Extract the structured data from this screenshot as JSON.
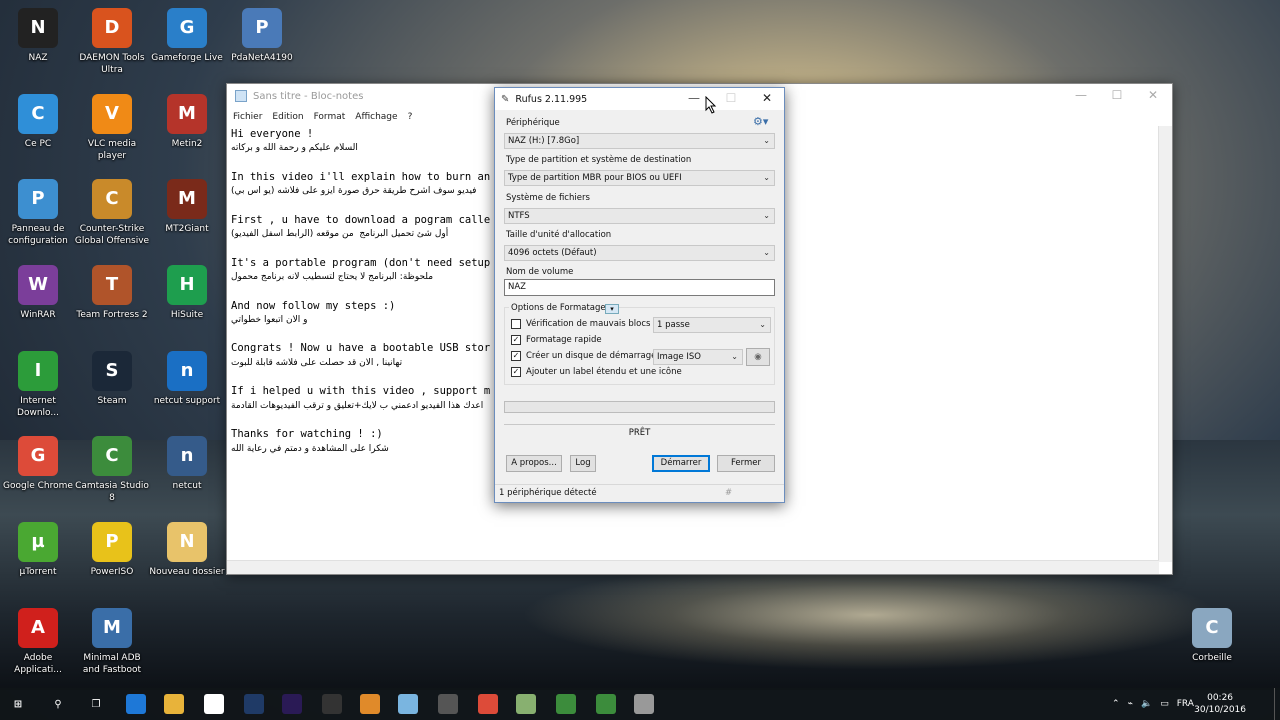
{
  "desktop": {
    "icons": [
      {
        "label": "NAZ",
        "icon": "ghost-icon",
        "color": "#222222"
      },
      {
        "label": "DAEMON Tools Ultra",
        "icon": "daemon-tools-icon",
        "color": "#d9531e"
      },
      {
        "label": "Gameforge Live",
        "icon": "gameforge-icon",
        "color": "#2a7fc9"
      },
      {
        "label": "PdaNetA4190",
        "icon": "pdanet-icon",
        "color": "#4a7ab8"
      },
      {
        "label": "Ce PC",
        "icon": "computer-icon",
        "color": "#2f8fd8"
      },
      {
        "label": "VLC media player",
        "icon": "vlc-icon",
        "color": "#f08a16"
      },
      {
        "label": "Metin2",
        "icon": "metin2-icon",
        "color": "#b5342a"
      },
      {
        "label": "Panneau de configuration",
        "icon": "control-panel-icon",
        "color": "#3d8fd0"
      },
      {
        "label": "Counter-Strike Global Offensive",
        "icon": "csgo-icon",
        "color": "#c98a2a"
      },
      {
        "label": "MT2Giant",
        "icon": "mt2giant-icon",
        "color": "#7a2a1a"
      },
      {
        "label": "WinRAR",
        "icon": "winrar-icon",
        "color": "#7b3e9a"
      },
      {
        "label": "Team Fortress 2",
        "icon": "tf2-icon",
        "color": "#b0542a"
      },
      {
        "label": "HiSuite",
        "icon": "hisuite-icon",
        "color": "#1e9e4e"
      },
      {
        "label": "Internet Downlo...",
        "icon": "idm-icon",
        "color": "#2c9c3a"
      },
      {
        "label": "Steam",
        "icon": "steam-icon",
        "color": "#1b2838"
      },
      {
        "label": "netcut support",
        "icon": "ie-icon",
        "color": "#1a6fc4"
      },
      {
        "label": "Google Chrome",
        "icon": "chrome-icon",
        "color": "#dd4b39"
      },
      {
        "label": "Camtasia Studio 8",
        "icon": "camtasia-icon",
        "color": "#3c8c3c"
      },
      {
        "label": "netcut",
        "icon": "netcut-icon",
        "color": "#355b8a"
      },
      {
        "label": "µTorrent",
        "icon": "utorrent-icon",
        "color": "#4aa832"
      },
      {
        "label": "PowerISO",
        "icon": "poweriso-icon",
        "color": "#e8c21a"
      },
      {
        "label": "Nouveau dossier",
        "icon": "folder-icon",
        "color": "#e8c36a"
      },
      {
        "label": "Adobe Applicati...",
        "icon": "adobe-icon",
        "color": "#d0201c"
      },
      {
        "label": "Minimal ADB and Fastboot",
        "icon": "adb-icon",
        "color": "#3a6ea8"
      },
      {
        "label": "Corbeille",
        "icon": "recycle-bin-icon",
        "color": "#8aa7c0"
      }
    ]
  },
  "notepad": {
    "title": "Sans titre - Bloc-notes",
    "menu": [
      "Fichier",
      "Edition",
      "Format",
      "Affichage",
      "?"
    ],
    "lines": [
      {
        "t": "Hi everyone !",
        "ar": false
      },
      {
        "t": "السلام عليكم و رحمة الله و بركاته",
        "ar": true
      },
      {
        "t": "",
        "ar": false
      },
      {
        "t": "In this video i'll explain how to burn an",
        "ar": false
      },
      {
        "t": "فيديو سوف اشرح طريقة حرق صورة ايزو على فلاشه (يو اس بي)",
        "ar": true
      },
      {
        "t": "",
        "ar": false
      },
      {
        "t": "First , u have to download a pogram calle",
        "ar": false
      },
      {
        "t": "أول شئ تحميل البرنامج  من موقعه (الرابط اسفل الفيديو)",
        "ar": true
      },
      {
        "t": "",
        "ar": false
      },
      {
        "t": "It's a portable program (don't need setup",
        "ar": false
      },
      {
        "t": "ملحوظة: البرنامج لا يحتاج لتسطيب لانه برنامج محمول",
        "ar": true
      },
      {
        "t": "",
        "ar": false
      },
      {
        "t": "And now follow my steps :)",
        "ar": false
      },
      {
        "t": "و الان اتبعوا خطواتي",
        "ar": true
      },
      {
        "t": "",
        "ar": false
      },
      {
        "t": "Congrats ! Now u have a bootable USB stor",
        "ar": false
      },
      {
        "t": "تهانينا , الان قد حصلت على فلاشه قابلة للبوت",
        "ar": true
      },
      {
        "t": "",
        "ar": false
      },
      {
        "t": "If i helped u with this video , support m",
        "ar": false
      },
      {
        "t": "اعدك هذا الفيديو ادعمني ب لايك+تعليق و ترقب الفيديوهات القادمة",
        "ar": true
      },
      {
        "t": "",
        "ar": false
      },
      {
        "t": "Thanks for watching ! :)",
        "ar": false
      },
      {
        "t": "شكرا على المشاهدة و دمتم في رعاية الله",
        "ar": true
      }
    ]
  },
  "rufus": {
    "title": "Rufus 2.11.995",
    "device_label": "Périphérique",
    "device_value": "NAZ (H:) [7.8Go]",
    "partition_label": "Type de partition et système de destination",
    "partition_value": "Type de partition MBR pour BIOS ou UEFI",
    "fs_label": "Système de fichiers",
    "fs_value": "NTFS",
    "cluster_label": "Taille d'unité d'allocation",
    "cluster_value": "4096 octets (Défaut)",
    "volume_label": "Nom de volume",
    "volume_value": "NAZ",
    "format_options_label": "Options de Formatage",
    "badblocks_label": "Vérification de mauvais blocs",
    "badblocks_checked": false,
    "passes_value": "1 passe",
    "quick_format_label": "Formatage rapide",
    "quick_format_checked": true,
    "bootable_label": "Créer un disque de démarrage",
    "bootable_checked": true,
    "boot_type_value": "Image ISO",
    "extended_label": "Ajouter un label étendu et une icône",
    "extended_checked": true,
    "status": "PRÊT",
    "about_button": "A propos...",
    "log_button": "Log",
    "start_button": "Démarrer",
    "close_button": "Fermer",
    "footer_text": "1 périphérique détecté",
    "footer_hash": "#"
  },
  "taskbar": {
    "apps": [
      {
        "name": "start-icon",
        "color": "#ffffff"
      },
      {
        "name": "search-icon",
        "color": "#ffffff"
      },
      {
        "name": "task-view-icon",
        "color": "#ffffff"
      },
      {
        "name": "edge-icon",
        "color": "#1e78d7"
      },
      {
        "name": "file-explorer-icon",
        "color": "#e8b33a"
      },
      {
        "name": "store-icon",
        "color": "#ffffff"
      },
      {
        "name": "photoshop-icon",
        "color": "#1f3a66"
      },
      {
        "name": "after-effects-icon",
        "color": "#2a1a55"
      },
      {
        "name": "cmd-icon",
        "color": "#333333"
      },
      {
        "name": "media-icon",
        "color": "#e08a2a"
      },
      {
        "name": "sticky-icon",
        "color": "#7ab5e0"
      },
      {
        "name": "calculator-icon",
        "color": "#555555"
      },
      {
        "name": "chrome-icon",
        "color": "#dd4b39"
      },
      {
        "name": "paint-icon",
        "color": "#88b070"
      },
      {
        "name": "camtasia-icon",
        "color": "#3c8c3c"
      },
      {
        "name": "camtasia-recorder-icon",
        "color": "#3c8c3c"
      },
      {
        "name": "rufus-icon",
        "color": "#999999"
      }
    ],
    "language": "FRA",
    "time": "00:26",
    "date": "30/10/2016"
  }
}
